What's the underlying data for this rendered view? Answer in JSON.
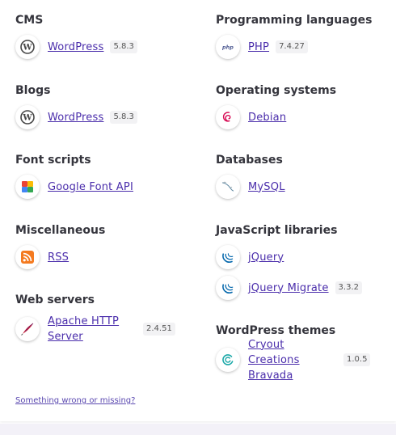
{
  "left_sections": [
    {
      "heading": "CMS",
      "items": [
        {
          "name": "WordPress",
          "version": "5.8.3",
          "icon": "wordpress-icon"
        }
      ]
    },
    {
      "heading": "Blogs",
      "items": [
        {
          "name": "WordPress",
          "version": "5.8.3",
          "icon": "wordpress-icon"
        }
      ]
    },
    {
      "heading": "Font scripts",
      "items": [
        {
          "name": "Google Font API",
          "version": "",
          "icon": "google-font-icon"
        }
      ]
    },
    {
      "heading": "Miscellaneous",
      "items": [
        {
          "name": "RSS",
          "version": "",
          "icon": "rss-icon"
        }
      ]
    },
    {
      "heading": "Web servers",
      "items": [
        {
          "name": "Apache HTTP Server",
          "version": "2.4.51",
          "icon": "apache-feather-icon"
        }
      ]
    }
  ],
  "right_sections": [
    {
      "heading": "Programming languages",
      "items": [
        {
          "name": "PHP",
          "version": "7.4.27",
          "icon": "php-icon"
        }
      ]
    },
    {
      "heading": "Operating systems",
      "items": [
        {
          "name": "Debian",
          "version": "",
          "icon": "debian-swirl-icon"
        }
      ]
    },
    {
      "heading": "Databases",
      "items": [
        {
          "name": "MySQL",
          "version": "",
          "icon": "mysql-dolphin-icon"
        }
      ]
    },
    {
      "heading": "JavaScript libraries",
      "items": [
        {
          "name": "jQuery",
          "version": "",
          "icon": "jquery-icon"
        },
        {
          "name": "jQuery Migrate",
          "version": "3.3.2",
          "icon": "jquery-icon"
        }
      ]
    },
    {
      "heading": "WordPress themes",
      "items": [
        {
          "name": "Cryout Creations Bravada",
          "version": "1.0.5",
          "icon": "cryout-theme-icon"
        }
      ]
    }
  ],
  "footer": {
    "report_link": "Something wrong or missing?"
  },
  "colors": {
    "link": "#4a2dab",
    "heading": "#35353d",
    "band": "#f3f1f8"
  }
}
